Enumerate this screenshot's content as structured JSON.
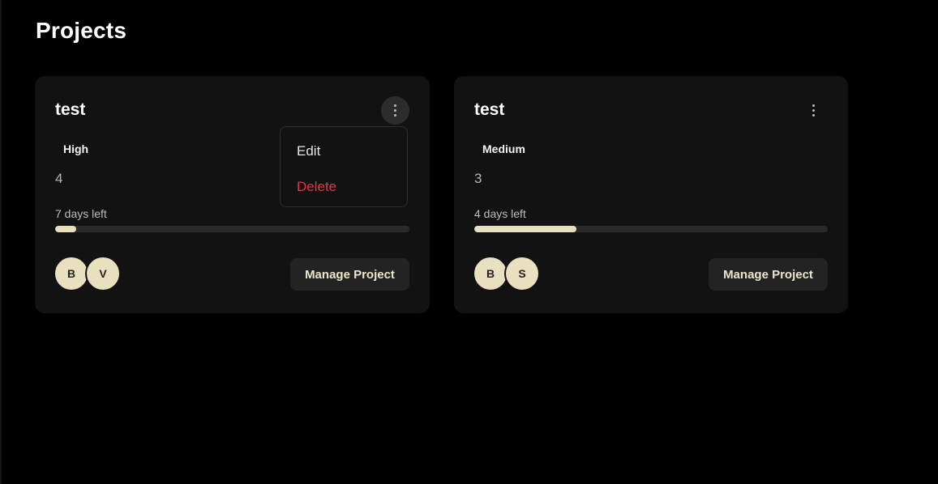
{
  "page": {
    "title": "Projects"
  },
  "colors": {
    "background": "#000000",
    "card": "#121212",
    "accent": "#e7dfbf",
    "danger": "#e0393e"
  },
  "projects": [
    {
      "title": "test",
      "priority": "High",
      "count": "4",
      "days_left": "7 days left",
      "progress_percent": 6,
      "members": [
        "B",
        "V"
      ],
      "manage_label": "Manage Project",
      "menu_open": true
    },
    {
      "title": "test",
      "priority": "Medium",
      "count": "3",
      "days_left": "4 days left",
      "progress_percent": 29,
      "members": [
        "B",
        "S"
      ],
      "manage_label": "Manage Project",
      "menu_open": false
    }
  ],
  "dropdown": {
    "edit_label": "Edit",
    "delete_label": "Delete"
  },
  "icons": {
    "menu": "more-vertical-icon"
  }
}
